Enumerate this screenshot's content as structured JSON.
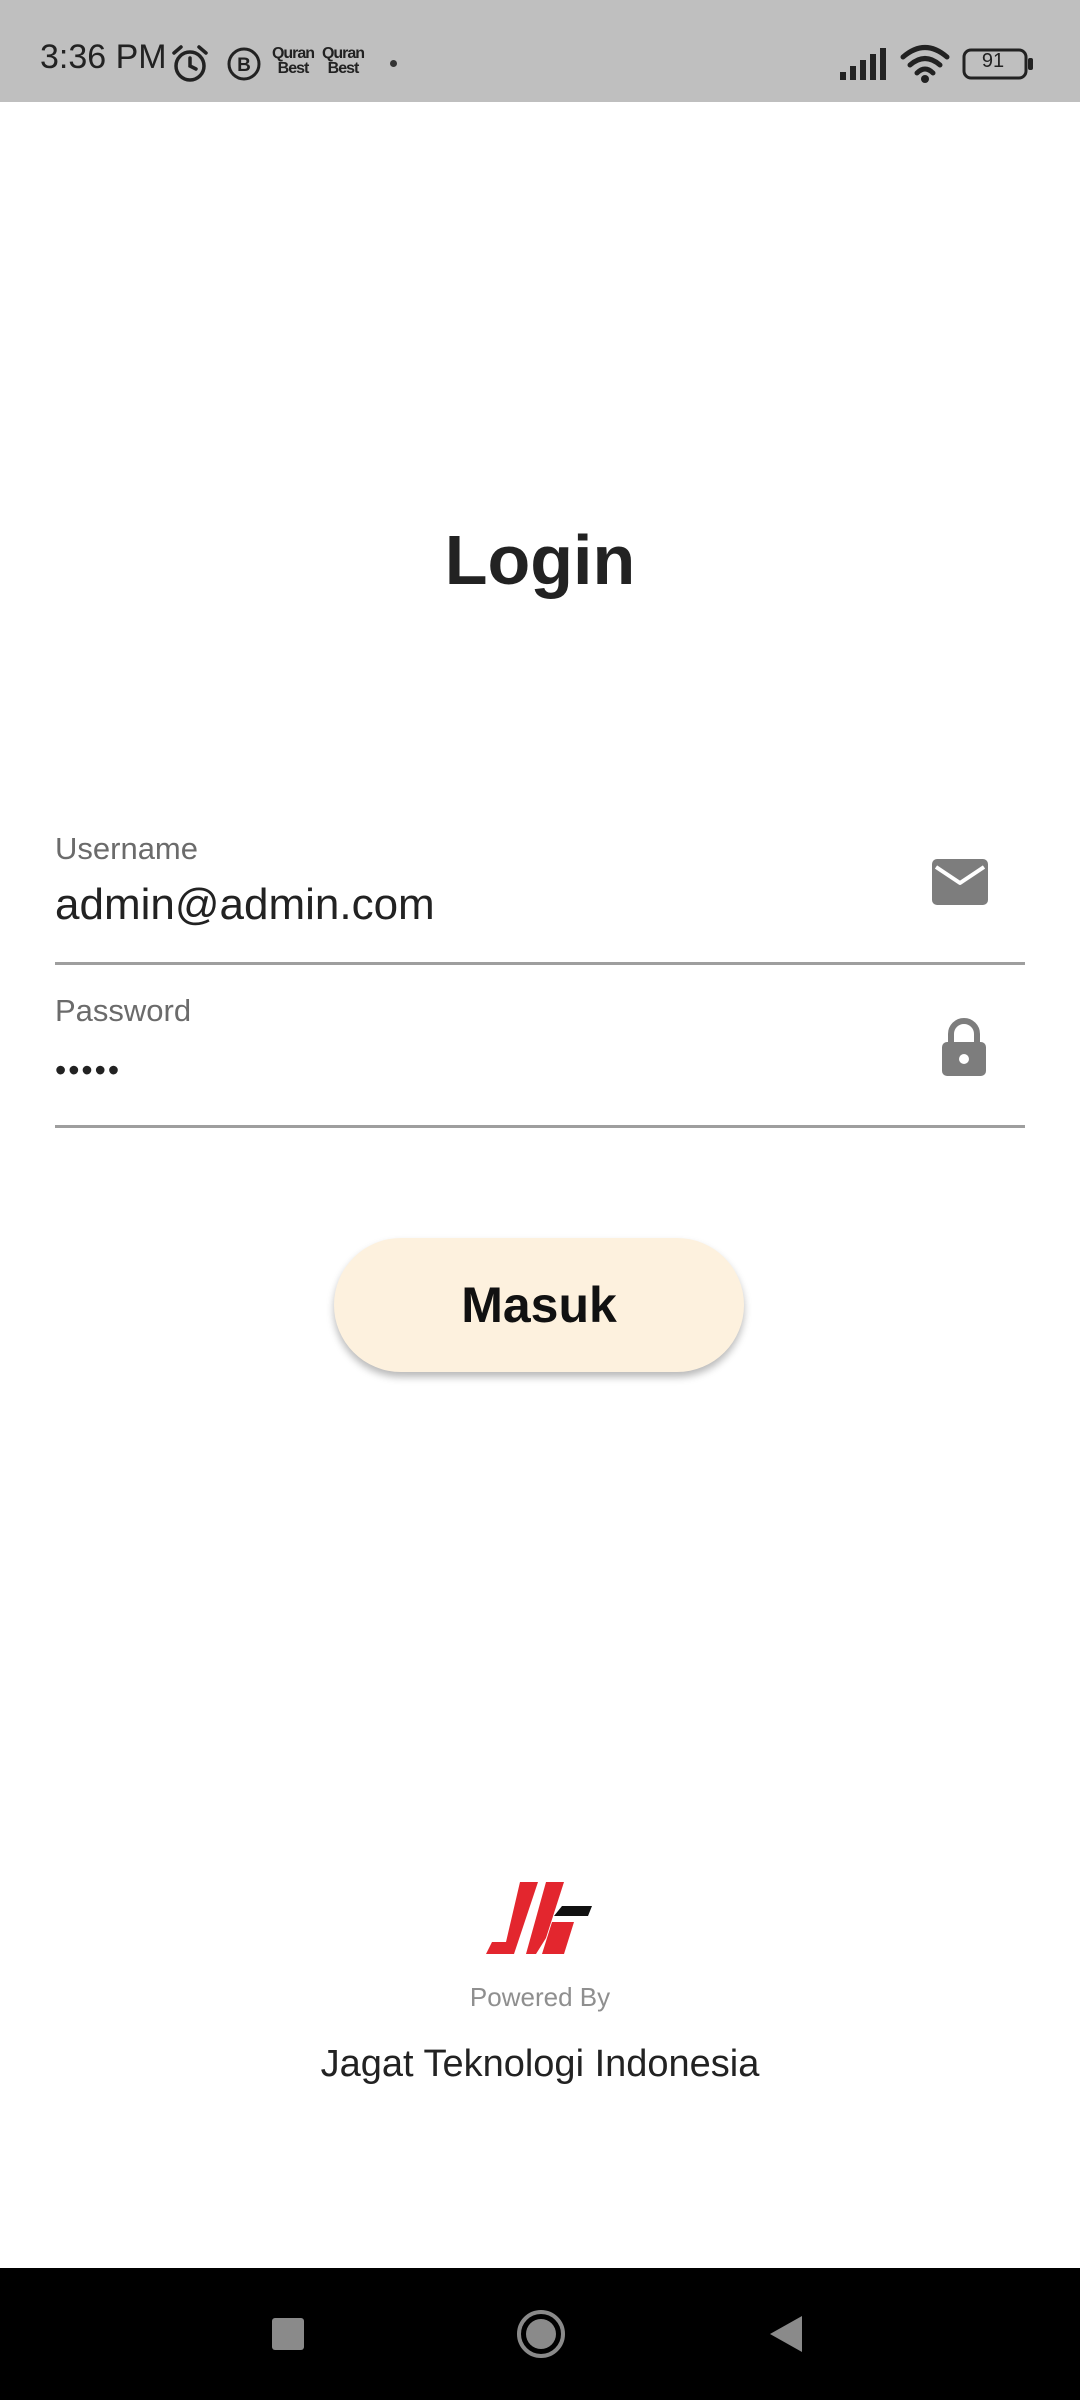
{
  "status_bar": {
    "time": "3:36 PM",
    "notification_icons": [
      "alarm-icon",
      "b-icon",
      "quran-best-icon",
      "quran-best-icon",
      "dot-icon"
    ],
    "quran_label_top": "Quran",
    "quran_label_bottom": "Best",
    "battery_level": "91"
  },
  "login": {
    "title": "Login",
    "username_label": "Username",
    "username_value": "admin@admin.com",
    "password_label": "Password",
    "password_masked": "•••••",
    "username_icon": "mail-icon",
    "password_icon": "lock-icon",
    "submit_label": "Masuk"
  },
  "footer": {
    "powered_by": "Powered By",
    "company": "Jagat Teknologi Indonesia"
  },
  "colors": {
    "status_bar_bg": "#bfbfbf",
    "button_bg": "#fdf1de",
    "logo_red": "#e3262e",
    "logo_black": "#111111",
    "icon_gray": "#7d7d7d"
  },
  "nav_bar": {
    "buttons": [
      "recents-button",
      "home-button",
      "back-button"
    ]
  }
}
